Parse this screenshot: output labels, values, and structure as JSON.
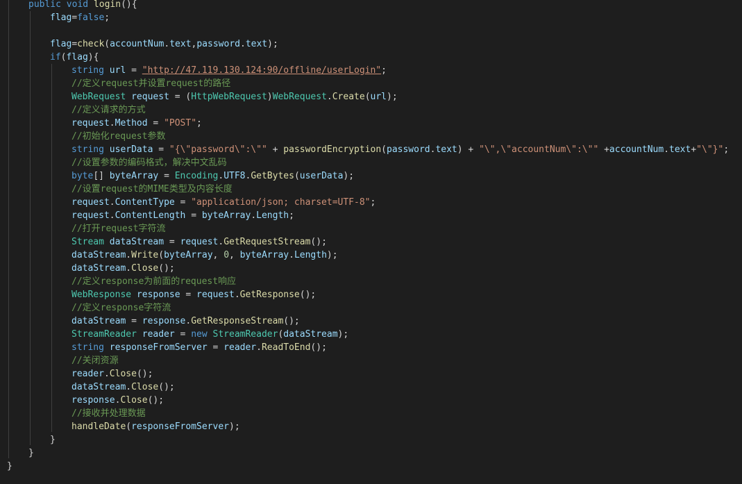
{
  "colors": {
    "background": "#1e1e1e",
    "keyword": "#569cd6",
    "type": "#4ec9b0",
    "function": "#dcdcaa",
    "variable": "#9cdcfe",
    "string": "#ce9178",
    "comment": "#6a9955",
    "number": "#b5cea8",
    "plain": "#d4d4d4"
  },
  "code": {
    "lines": [
      {
        "indent": 1,
        "tokens": [
          {
            "t": "public void ",
            "c": "kw"
          },
          {
            "t": "login",
            "c": "fn"
          },
          {
            "t": "(){",
            "c": "pl"
          }
        ]
      },
      {
        "indent": 2,
        "tokens": [
          {
            "t": "flag",
            "c": "va"
          },
          {
            "t": "=",
            "c": "pl"
          },
          {
            "t": "false",
            "c": "kw"
          },
          {
            "t": ";",
            "c": "pl"
          }
        ]
      },
      {
        "indent": 0,
        "tokens": []
      },
      {
        "indent": 2,
        "tokens": [
          {
            "t": "flag",
            "c": "va"
          },
          {
            "t": "=",
            "c": "pl"
          },
          {
            "t": "check",
            "c": "fn"
          },
          {
            "t": "(",
            "c": "pl"
          },
          {
            "t": "accountNum",
            "c": "va"
          },
          {
            "t": ".",
            "c": "pl"
          },
          {
            "t": "text",
            "c": "va"
          },
          {
            "t": ",",
            "c": "pl"
          },
          {
            "t": "password",
            "c": "va"
          },
          {
            "t": ".",
            "c": "pl"
          },
          {
            "t": "text",
            "c": "va"
          },
          {
            "t": ");",
            "c": "pl"
          }
        ]
      },
      {
        "indent": 2,
        "tokens": [
          {
            "t": "if",
            "c": "kw"
          },
          {
            "t": "(",
            "c": "pl"
          },
          {
            "t": "flag",
            "c": "va"
          },
          {
            "t": "){",
            "c": "pl"
          }
        ]
      },
      {
        "indent": 3,
        "tokens": [
          {
            "t": "string ",
            "c": "kw"
          },
          {
            "t": "url",
            "c": "va"
          },
          {
            "t": " = ",
            "c": "pl"
          },
          {
            "t": "\"http://47.119.130.124:90/offline/userLogin\"",
            "c": "st ul"
          },
          {
            "t": ";",
            "c": "pl"
          }
        ]
      },
      {
        "indent": 3,
        "tokens": [
          {
            "t": "//定义request并设置request的路径",
            "c": "cm"
          }
        ]
      },
      {
        "indent": 3,
        "tokens": [
          {
            "t": "WebRequest",
            "c": "ty"
          },
          {
            "t": " ",
            "c": "pl"
          },
          {
            "t": "request",
            "c": "va"
          },
          {
            "t": " = (",
            "c": "pl"
          },
          {
            "t": "HttpWebRequest",
            "c": "ty"
          },
          {
            "t": ")",
            "c": "pl"
          },
          {
            "t": "WebRequest",
            "c": "ty"
          },
          {
            "t": ".",
            "c": "pl"
          },
          {
            "t": "Create",
            "c": "fn"
          },
          {
            "t": "(",
            "c": "pl"
          },
          {
            "t": "url",
            "c": "va"
          },
          {
            "t": ");",
            "c": "pl"
          }
        ]
      },
      {
        "indent": 3,
        "tokens": [
          {
            "t": "//定义请求的方式",
            "c": "cm"
          }
        ]
      },
      {
        "indent": 3,
        "tokens": [
          {
            "t": "request",
            "c": "va"
          },
          {
            "t": ".",
            "c": "pl"
          },
          {
            "t": "Method",
            "c": "va"
          },
          {
            "t": " = ",
            "c": "pl"
          },
          {
            "t": "\"POST\"",
            "c": "st"
          },
          {
            "t": ";",
            "c": "pl"
          }
        ]
      },
      {
        "indent": 3,
        "tokens": [
          {
            "t": "//初始化request参数",
            "c": "cm"
          }
        ]
      },
      {
        "indent": 3,
        "tokens": [
          {
            "t": "string ",
            "c": "kw"
          },
          {
            "t": "userData",
            "c": "va"
          },
          {
            "t": " = ",
            "c": "pl"
          },
          {
            "t": "\"{\\\"password\\\":\\\"\"",
            "c": "st"
          },
          {
            "t": " + ",
            "c": "pl"
          },
          {
            "t": "passwordEncryption",
            "c": "fn"
          },
          {
            "t": "(",
            "c": "pl"
          },
          {
            "t": "password",
            "c": "va"
          },
          {
            "t": ".",
            "c": "pl"
          },
          {
            "t": "text",
            "c": "va"
          },
          {
            "t": ") + ",
            "c": "pl"
          },
          {
            "t": "\"\\\",\\\"accountNum\\\":\\\"\"",
            "c": "st"
          },
          {
            "t": " +",
            "c": "pl"
          },
          {
            "t": "accountNum",
            "c": "va"
          },
          {
            "t": ".",
            "c": "pl"
          },
          {
            "t": "text",
            "c": "va"
          },
          {
            "t": "+",
            "c": "pl"
          },
          {
            "t": "\"\\\"}\"",
            "c": "st"
          },
          {
            "t": ";",
            "c": "pl"
          }
        ]
      },
      {
        "indent": 3,
        "tokens": [
          {
            "t": "//设置参数的编码格式，解决中文乱码",
            "c": "cm"
          }
        ]
      },
      {
        "indent": 3,
        "tokens": [
          {
            "t": "byte",
            "c": "kw"
          },
          {
            "t": "[] ",
            "c": "pl"
          },
          {
            "t": "byteArray",
            "c": "va"
          },
          {
            "t": " = ",
            "c": "pl"
          },
          {
            "t": "Encoding",
            "c": "ty"
          },
          {
            "t": ".",
            "c": "pl"
          },
          {
            "t": "UTF8",
            "c": "va"
          },
          {
            "t": ".",
            "c": "pl"
          },
          {
            "t": "GetBytes",
            "c": "fn"
          },
          {
            "t": "(",
            "c": "pl"
          },
          {
            "t": "userData",
            "c": "va"
          },
          {
            "t": ");",
            "c": "pl"
          }
        ]
      },
      {
        "indent": 3,
        "tokens": [
          {
            "t": "//设置request的MIME类型及内容长度",
            "c": "cm"
          }
        ]
      },
      {
        "indent": 3,
        "tokens": [
          {
            "t": "request",
            "c": "va"
          },
          {
            "t": ".",
            "c": "pl"
          },
          {
            "t": "ContentType",
            "c": "va"
          },
          {
            "t": " = ",
            "c": "pl"
          },
          {
            "t": "\"application/json; charset=UTF-8\"",
            "c": "st"
          },
          {
            "t": ";",
            "c": "pl"
          }
        ]
      },
      {
        "indent": 3,
        "tokens": [
          {
            "t": "request",
            "c": "va"
          },
          {
            "t": ".",
            "c": "pl"
          },
          {
            "t": "ContentLength",
            "c": "va"
          },
          {
            "t": " = ",
            "c": "pl"
          },
          {
            "t": "byteArray",
            "c": "va"
          },
          {
            "t": ".",
            "c": "pl"
          },
          {
            "t": "Length",
            "c": "va"
          },
          {
            "t": ";",
            "c": "pl"
          }
        ]
      },
      {
        "indent": 3,
        "tokens": [
          {
            "t": "//打开request字符流",
            "c": "cm"
          }
        ]
      },
      {
        "indent": 3,
        "tokens": [
          {
            "t": "Stream",
            "c": "ty"
          },
          {
            "t": " ",
            "c": "pl"
          },
          {
            "t": "dataStream",
            "c": "va"
          },
          {
            "t": " = ",
            "c": "pl"
          },
          {
            "t": "request",
            "c": "va"
          },
          {
            "t": ".",
            "c": "pl"
          },
          {
            "t": "GetRequestStream",
            "c": "fn"
          },
          {
            "t": "();",
            "c": "pl"
          }
        ]
      },
      {
        "indent": 3,
        "tokens": [
          {
            "t": "dataStream",
            "c": "va"
          },
          {
            "t": ".",
            "c": "pl"
          },
          {
            "t": "Write",
            "c": "fn"
          },
          {
            "t": "(",
            "c": "pl"
          },
          {
            "t": "byteArray",
            "c": "va"
          },
          {
            "t": ", ",
            "c": "pl"
          },
          {
            "t": "0",
            "c": "nu"
          },
          {
            "t": ", ",
            "c": "pl"
          },
          {
            "t": "byteArray",
            "c": "va"
          },
          {
            "t": ".",
            "c": "pl"
          },
          {
            "t": "Length",
            "c": "va"
          },
          {
            "t": ");",
            "c": "pl"
          }
        ]
      },
      {
        "indent": 3,
        "tokens": [
          {
            "t": "dataStream",
            "c": "va"
          },
          {
            "t": ".",
            "c": "pl"
          },
          {
            "t": "Close",
            "c": "fn"
          },
          {
            "t": "();",
            "c": "pl"
          }
        ]
      },
      {
        "indent": 3,
        "tokens": [
          {
            "t": "//定义response为前面的request响应",
            "c": "cm"
          }
        ]
      },
      {
        "indent": 3,
        "tokens": [
          {
            "t": "WebResponse",
            "c": "ty"
          },
          {
            "t": " ",
            "c": "pl"
          },
          {
            "t": "response",
            "c": "va"
          },
          {
            "t": " = ",
            "c": "pl"
          },
          {
            "t": "request",
            "c": "va"
          },
          {
            "t": ".",
            "c": "pl"
          },
          {
            "t": "GetResponse",
            "c": "fn"
          },
          {
            "t": "();",
            "c": "pl"
          }
        ]
      },
      {
        "indent": 3,
        "tokens": [
          {
            "t": "//定义response字符流",
            "c": "cm"
          }
        ]
      },
      {
        "indent": 3,
        "tokens": [
          {
            "t": "dataStream",
            "c": "va"
          },
          {
            "t": " = ",
            "c": "pl"
          },
          {
            "t": "response",
            "c": "va"
          },
          {
            "t": ".",
            "c": "pl"
          },
          {
            "t": "GetResponseStream",
            "c": "fn"
          },
          {
            "t": "();",
            "c": "pl"
          }
        ]
      },
      {
        "indent": 3,
        "tokens": [
          {
            "t": "StreamReader",
            "c": "ty"
          },
          {
            "t": " ",
            "c": "pl"
          },
          {
            "t": "reader",
            "c": "va"
          },
          {
            "t": " = ",
            "c": "pl"
          },
          {
            "t": "new ",
            "c": "kw"
          },
          {
            "t": "StreamReader",
            "c": "ty"
          },
          {
            "t": "(",
            "c": "pl"
          },
          {
            "t": "dataStream",
            "c": "va"
          },
          {
            "t": ");",
            "c": "pl"
          }
        ]
      },
      {
        "indent": 3,
        "tokens": [
          {
            "t": "string ",
            "c": "kw"
          },
          {
            "t": "responseFromServer",
            "c": "va"
          },
          {
            "t": " = ",
            "c": "pl"
          },
          {
            "t": "reader",
            "c": "va"
          },
          {
            "t": ".",
            "c": "pl"
          },
          {
            "t": "ReadToEnd",
            "c": "fn"
          },
          {
            "t": "();",
            "c": "pl"
          }
        ]
      },
      {
        "indent": 3,
        "tokens": [
          {
            "t": "//关闭资源",
            "c": "cm"
          }
        ]
      },
      {
        "indent": 3,
        "tokens": [
          {
            "t": "reader",
            "c": "va"
          },
          {
            "t": ".",
            "c": "pl"
          },
          {
            "t": "Close",
            "c": "fn"
          },
          {
            "t": "();",
            "c": "pl"
          }
        ]
      },
      {
        "indent": 3,
        "tokens": [
          {
            "t": "dataStream",
            "c": "va"
          },
          {
            "t": ".",
            "c": "pl"
          },
          {
            "t": "Close",
            "c": "fn"
          },
          {
            "t": "();",
            "c": "pl"
          }
        ]
      },
      {
        "indent": 3,
        "tokens": [
          {
            "t": "response",
            "c": "va"
          },
          {
            "t": ".",
            "c": "pl"
          },
          {
            "t": "Close",
            "c": "fn"
          },
          {
            "t": "();",
            "c": "pl"
          }
        ]
      },
      {
        "indent": 3,
        "tokens": [
          {
            "t": "//接收并处理数据",
            "c": "cm"
          }
        ]
      },
      {
        "indent": 3,
        "tokens": [
          {
            "t": "handleDate",
            "c": "fn"
          },
          {
            "t": "(",
            "c": "pl"
          },
          {
            "t": "responseFromServer",
            "c": "va"
          },
          {
            "t": ");",
            "c": "pl"
          }
        ]
      },
      {
        "indent": 2,
        "tokens": [
          {
            "t": "}",
            "c": "pl"
          }
        ]
      },
      {
        "indent": 1,
        "tokens": [
          {
            "t": "}",
            "c": "pl"
          }
        ]
      },
      {
        "indent": 0,
        "tokens": [
          {
            "t": "}",
            "c": "pl"
          }
        ]
      }
    ]
  }
}
